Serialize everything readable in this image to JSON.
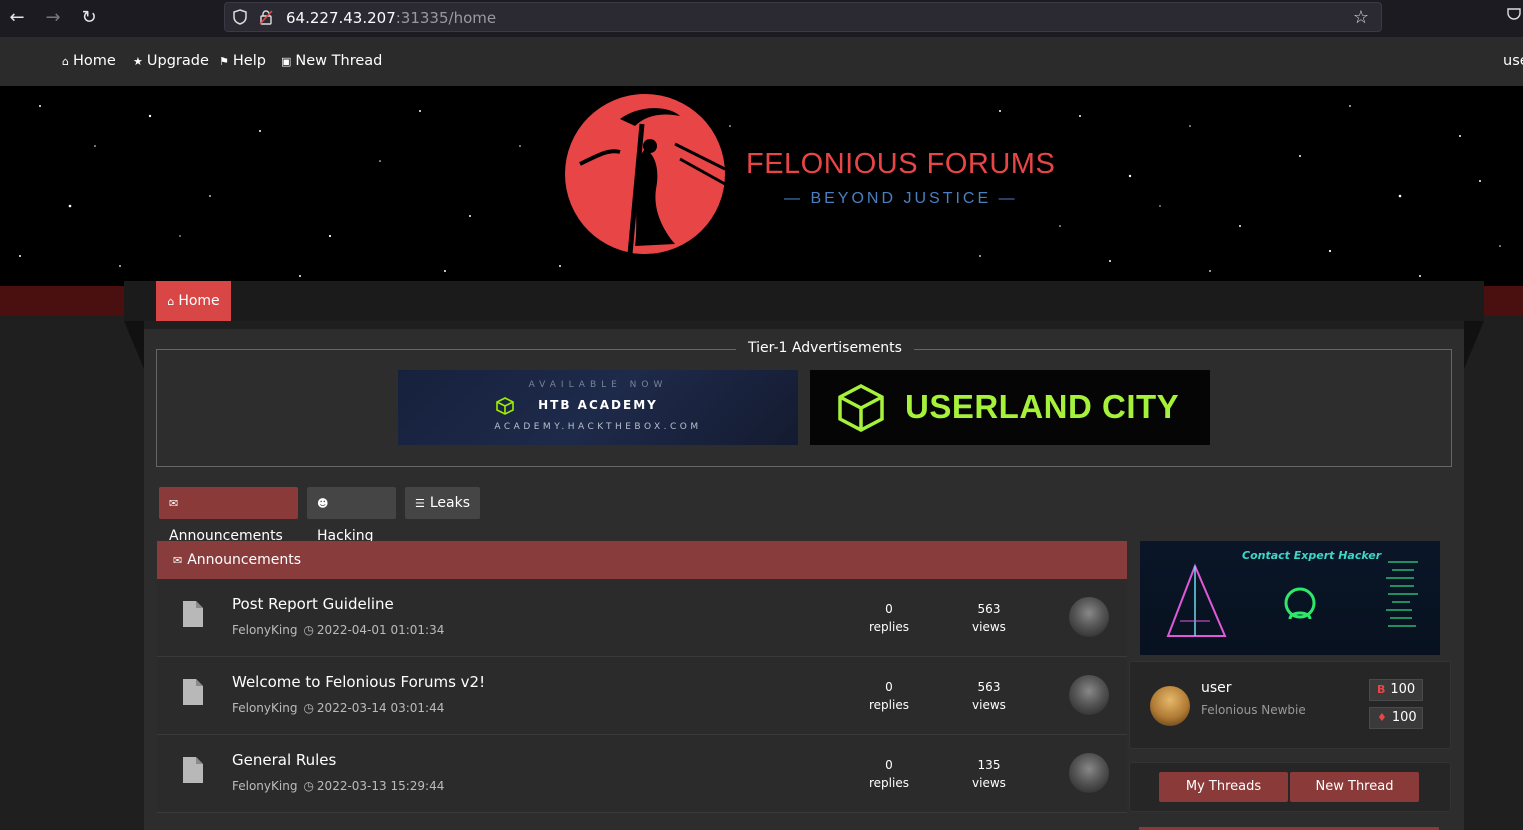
{
  "browser": {
    "url_host": "64.227.43.207",
    "url_rest": ":31335/home"
  },
  "topnav": {
    "items": [
      {
        "label": "Home",
        "icon": "home-icon"
      },
      {
        "label": "Upgrade",
        "icon": "star-icon"
      },
      {
        "label": "Help",
        "icon": "flag-icon"
      },
      {
        "label": "New Thread",
        "icon": "new-thread-icon"
      }
    ],
    "user_label": "use"
  },
  "brand": {
    "title": "FELONIOUS FORUMS",
    "tagline": "— BEYOND JUSTICE —",
    "accent": "#e84646"
  },
  "nav": {
    "home_tab": "Home"
  },
  "ads": {
    "legend": "Tier-1 Advertisements",
    "htb": {
      "line1": "AVAILABLE NOW",
      "line2": "HTB ACADEMY",
      "line3": "ACADEMY.HACKTHEBOX.COM"
    },
    "userland": {
      "text": "USERLAND CITY"
    }
  },
  "categories": [
    {
      "label": "Announcements",
      "icon": "megaphone-icon"
    },
    {
      "label": "Hacking",
      "icon": "hacker-icon"
    },
    {
      "label": "Leaks",
      "icon": "database-icon"
    }
  ],
  "threads_section": {
    "title": "Announcements",
    "threads": [
      {
        "title": "Post Report Guideline",
        "author": "FelonyKing",
        "date": "2022-04-01 01:01:34",
        "replies": "0",
        "replies_label": "replies",
        "views": "563",
        "views_label": "views"
      },
      {
        "title": "Welcome to Felonious Forums v2!",
        "author": "FelonyKing",
        "date": "2022-03-14 03:01:44",
        "replies": "0",
        "replies_label": "replies",
        "views": "563",
        "views_label": "views"
      },
      {
        "title": "General Rules",
        "author": "FelonyKing",
        "date": "2022-03-13 15:29:44",
        "replies": "0",
        "replies_label": "replies",
        "views": "135",
        "views_label": "views"
      }
    ]
  },
  "sidebar": {
    "ad_title": "Contact Expert Hacker",
    "profile": {
      "name": "user",
      "rank": "Felonious Newbie",
      "coins": "100",
      "rep": "100"
    },
    "buttons": {
      "my_threads": "My Threads",
      "new_thread": "New Thread"
    }
  }
}
